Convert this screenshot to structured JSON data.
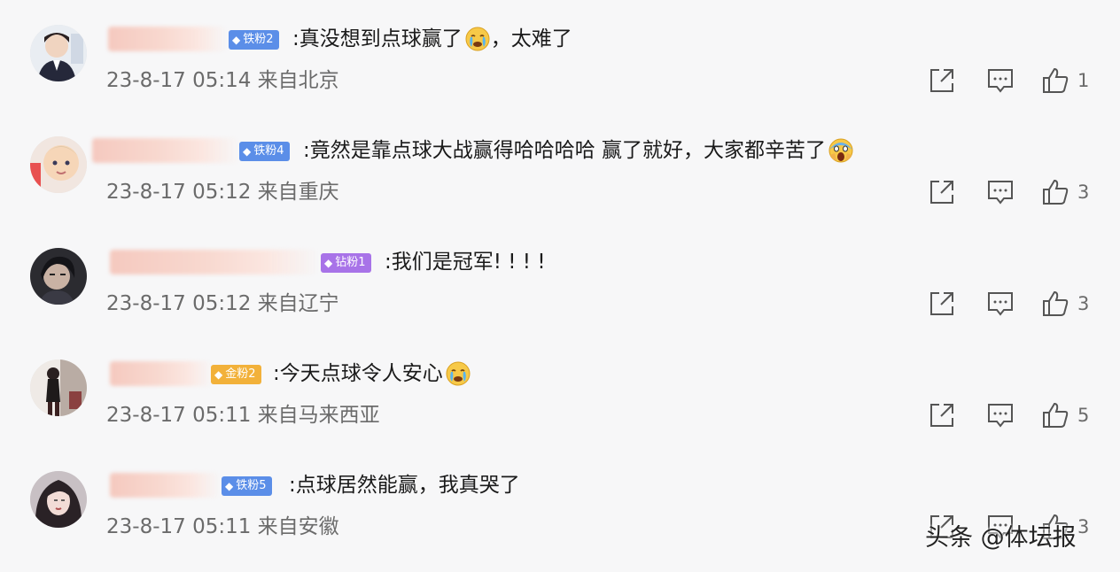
{
  "comments": [
    {
      "badge": "铁粉2",
      "badge_color": "#5b8ee8",
      "text": ":真没想到点球赢了",
      "emoji": "crying-face",
      "text_after": "，太难了",
      "timestamp": "23-8-17 05:14",
      "location": "来自北京",
      "likes": "1"
    },
    {
      "badge": "铁粉4",
      "badge_color": "#5b8ee8",
      "text": ":竟然是靠点球大战赢得哈哈哈哈 赢了就好，大家都辛苦了",
      "emoji": "screaming-face",
      "text_after": "",
      "timestamp": "23-8-17 05:12",
      "location": "来自重庆",
      "likes": "3"
    },
    {
      "badge": "钻粉1",
      "badge_color": "#a873e8",
      "text": ":我们是冠军! ! ! !",
      "emoji": "",
      "text_after": "",
      "timestamp": "23-8-17 05:12",
      "location": "来自辽宁",
      "likes": "3"
    },
    {
      "badge": "金粉2",
      "badge_color": "#f2b13a",
      "text": ":今天点球令人安心",
      "emoji": "crying-face",
      "text_after": "",
      "timestamp": "23-8-17 05:11",
      "location": "来自马来西亚",
      "likes": "5"
    },
    {
      "badge": "铁粉5",
      "badge_color": "#5b8ee8",
      "text": ":点球居然能赢，我真哭了",
      "emoji": "",
      "text_after": "",
      "timestamp": "23-8-17 05:11",
      "location": "来自安徽",
      "likes": "3"
    }
  ],
  "icons": {
    "share": "share-icon",
    "reply": "comment-icon",
    "like": "thumbs-up-icon",
    "badge": "diamond-icon"
  },
  "watermark": "头条 @体坛报"
}
